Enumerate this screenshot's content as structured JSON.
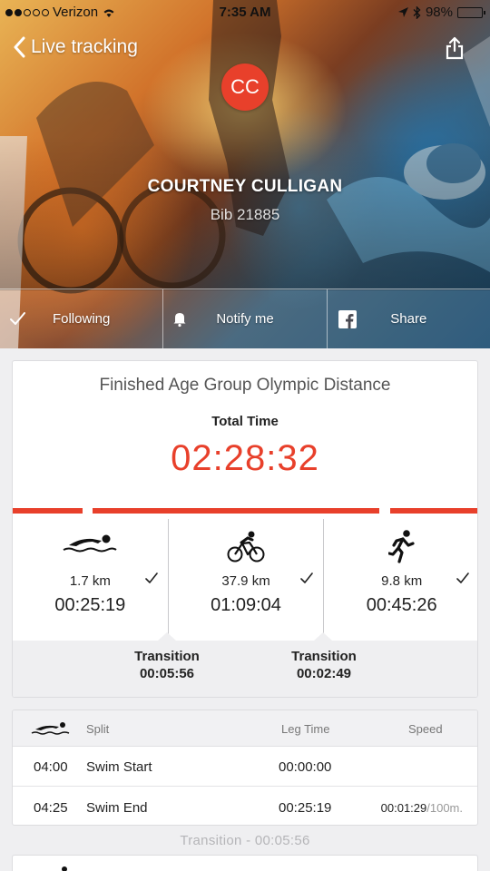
{
  "status_bar": {
    "carrier": "Verizon",
    "time": "7:35 AM",
    "battery": "98%",
    "battery_level": 0.98
  },
  "nav": {
    "back_label": "Live tracking"
  },
  "athlete": {
    "initials": "CC",
    "name": "COURTNEY CULLIGAN",
    "bib": "Bib 21885"
  },
  "actions": [
    {
      "label": "Following",
      "icon": "check-icon"
    },
    {
      "label": "Notify me",
      "icon": "bell-icon"
    },
    {
      "label": "Share",
      "icon": "facebook-icon"
    }
  ],
  "summary": {
    "title": "Finished Age Group Olympic Distance",
    "total_time_label": "Total Time",
    "total_time": "02:28:32"
  },
  "legs": [
    {
      "icon": "swim-icon",
      "distance": "1.7 km",
      "time": "00:25:19"
    },
    {
      "icon": "bike-icon",
      "distance": "37.9 km",
      "time": "01:09:04"
    },
    {
      "icon": "run-icon",
      "distance": "9.8 km",
      "time": "00:45:26"
    }
  ],
  "transitions": [
    {
      "label": "Transition",
      "time": "00:05:56"
    },
    {
      "label": "Transition",
      "time": "00:02:49"
    }
  ],
  "splits": {
    "headers": {
      "split": "Split",
      "leg_time": "Leg Time",
      "speed": "Speed"
    },
    "rows": [
      {
        "time": "04:00",
        "name": "Swim Start",
        "leg_time": "00:00:00",
        "speed": "",
        "speed_unit": ""
      },
      {
        "time": "04:25",
        "name": "Swim End",
        "leg_time": "00:25:19",
        "speed": "00:01:29",
        "speed_unit": "/100m."
      }
    ]
  },
  "transition_separator": "Transition - 00:05:56",
  "colors": {
    "accent": "#e8402b",
    "background": "#efeff1"
  }
}
